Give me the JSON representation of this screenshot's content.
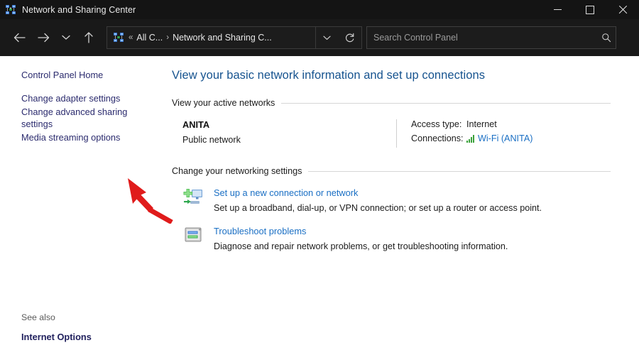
{
  "window": {
    "title": "Network and Sharing Center",
    "icon": "network-sharing-icon",
    "controls": {
      "minimize": "Minimize",
      "maximize": "Maximize",
      "close": "Close"
    }
  },
  "navbar": {
    "back": "Back",
    "forward": "Forward",
    "recent": "Recent locations",
    "up": "Up",
    "refresh": "Refresh",
    "breadcrumb": {
      "icon": "control-panel-icon",
      "overflow": "«",
      "items": [
        "All C...",
        "Network and Sharing C..."
      ],
      "separator": "›",
      "dropdown": "Previous locations"
    },
    "search": {
      "placeholder": "Search Control Panel",
      "value": "",
      "icon": "search-icon"
    }
  },
  "sidebar": {
    "home": "Control Panel Home",
    "links": [
      "Change adapter settings",
      "Change advanced sharing settings",
      "Media streaming options"
    ],
    "see_also": {
      "title": "See also",
      "links": [
        "Internet Options"
      ]
    }
  },
  "main": {
    "heading": "View your basic network information and set up connections",
    "sections": [
      {
        "label": "View your active networks"
      },
      {
        "label": "Change your networking settings"
      }
    ],
    "active_network": {
      "name": "ANITA",
      "type": "Public network",
      "details": [
        {
          "label": "Access type:",
          "value": "Internet",
          "is_link": false
        },
        {
          "label": "Connections:",
          "value": "Wi-Fi (ANITA)",
          "is_link": true,
          "icon": "wifi-signal-icon"
        }
      ]
    },
    "tasks": [
      {
        "icon": "new-connection-icon",
        "title": "Set up a new connection or network",
        "description": "Set up a broadband, dial-up, or VPN connection; or set up a router or access point."
      },
      {
        "icon": "troubleshoot-icon",
        "title": "Troubleshoot problems",
        "description": "Diagnose and repair network problems, or get troubleshooting information."
      }
    ]
  },
  "annotation": {
    "arrow": "red-arrow-pointer",
    "color": "#e01b1b",
    "points_at": "Change advanced sharing settings"
  },
  "colors": {
    "titlebar": "#141414",
    "navbar": "#191919",
    "content": "#ffffff",
    "heading_blue": "#16538f",
    "link_blue": "#1a6fc4",
    "sidebar_link": "#2b2b6e",
    "signal_green": "#3aa13a",
    "annotation_red": "#e01b1b"
  }
}
